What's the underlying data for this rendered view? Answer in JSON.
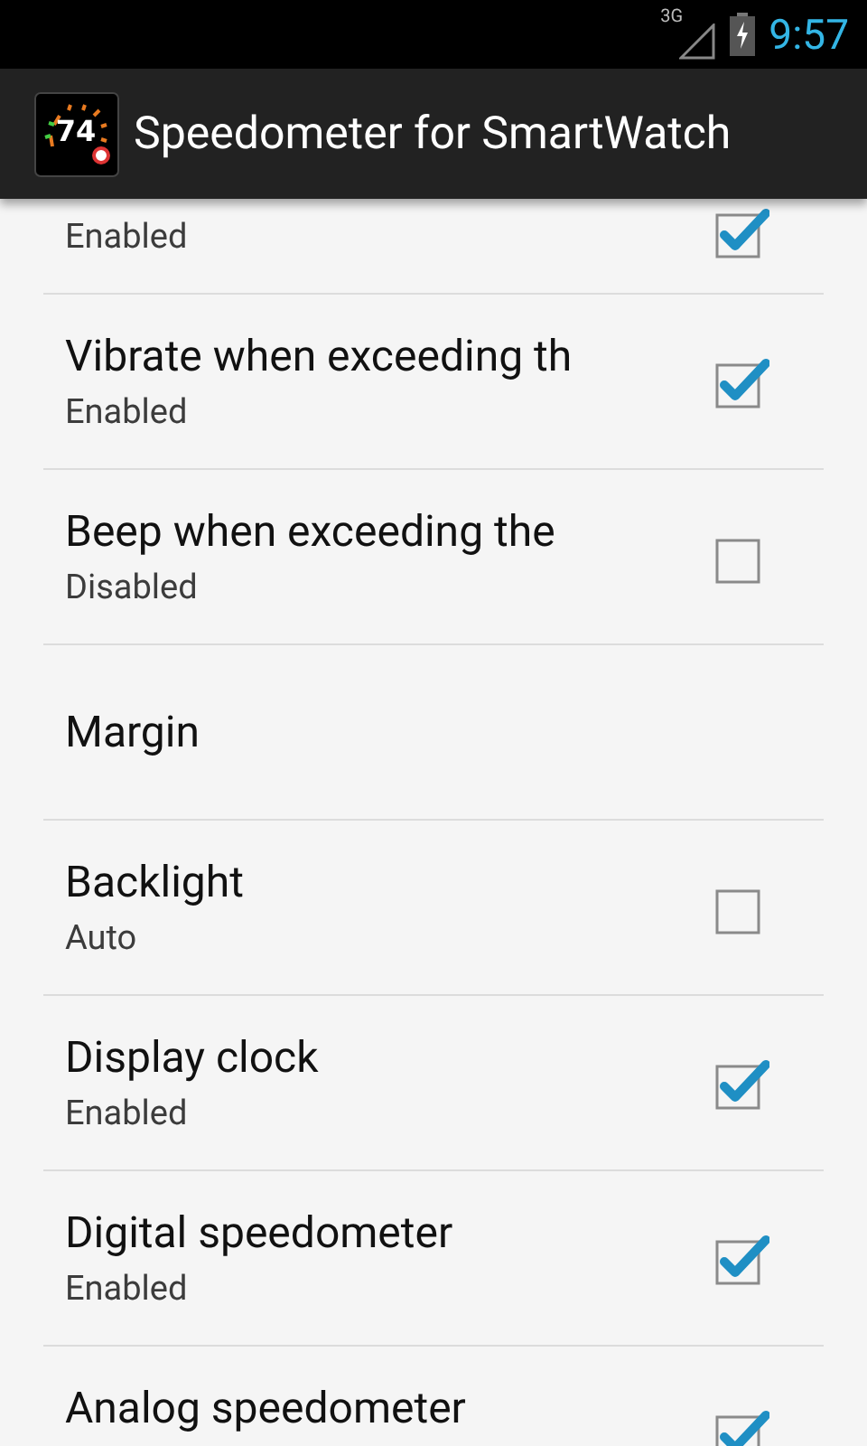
{
  "status_bar": {
    "network": "3G",
    "time": "9:57"
  },
  "action_bar": {
    "app_icon": {
      "reading": "74"
    },
    "title": "Speedometer for SmartWatch"
  },
  "preferences": [
    {
      "kind": "checkbox",
      "summary": "Enabled",
      "checked": true
    },
    {
      "kind": "checkbox",
      "title": "Vibrate when exceeding th",
      "summary": "Enabled",
      "checked": true
    },
    {
      "kind": "checkbox",
      "title": "Beep when exceeding the",
      "summary": "Disabled",
      "checked": false
    },
    {
      "kind": "plain",
      "title": "Margin"
    },
    {
      "kind": "checkbox",
      "title": "Backlight",
      "summary": "Auto",
      "checked": false
    },
    {
      "kind": "checkbox",
      "title": "Display clock",
      "summary": "Enabled",
      "checked": true
    },
    {
      "kind": "checkbox",
      "title": "Digital speedometer",
      "summary": "Enabled",
      "checked": true
    },
    {
      "kind": "checkbox",
      "title": "Analog speedometer",
      "checked": true
    }
  ]
}
